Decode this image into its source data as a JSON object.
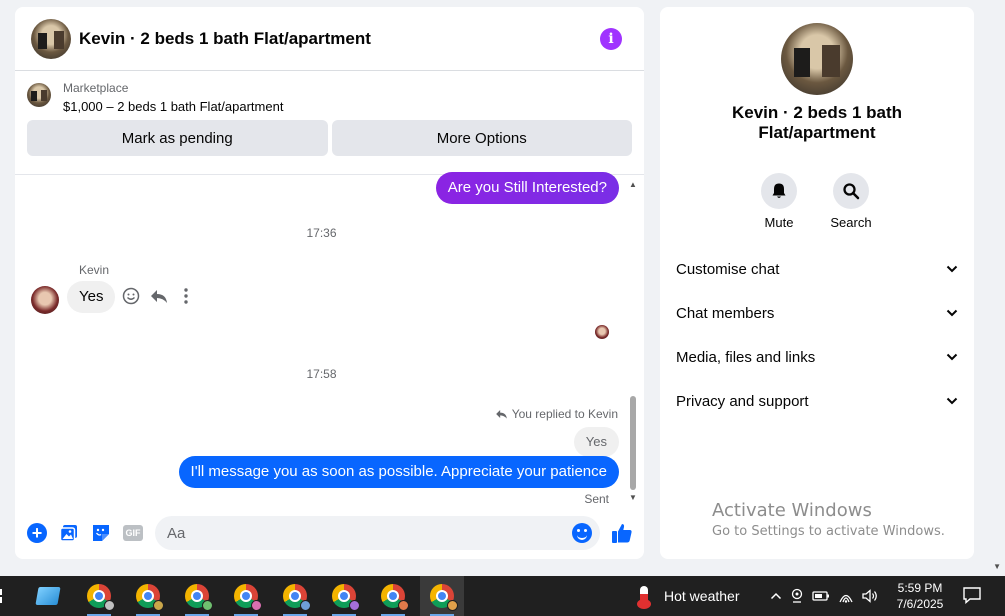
{
  "chat": {
    "title": "Kevin · 2 beds 1 bath Flat/apartment",
    "info_icon": "i",
    "marketplace": {
      "label": "Marketplace",
      "listing": "$1,000 – 2 beds 1 bath Flat/apartment"
    },
    "actions": {
      "mark_pending": "Mark as pending",
      "more_options": "More Options"
    },
    "messages": {
      "outgoing_question": "Are you Still Interested?",
      "time_1": "17:36",
      "sender_name": "Kevin",
      "incoming_reply": "Yes",
      "time_2": "17:58",
      "replied_note": "You replied to Kevin",
      "quoted": "Yes",
      "outgoing_reply": "I'll message you as soon as possible. Appreciate your patience",
      "status": "Sent"
    },
    "composer": {
      "placeholder": "Aa",
      "gif_label": "GIF"
    }
  },
  "info_panel": {
    "name": "Kevin · 2 beds 1 bath Flat/apartment",
    "mute_label": "Mute",
    "search_label": "Search",
    "sections": [
      "Customise chat",
      "Chat members",
      "Media, files and links",
      "Privacy and support"
    ]
  },
  "watermark": {
    "title": "Activate Windows",
    "subtitle": "Go to Settings to activate Windows."
  },
  "taskbar": {
    "weather": "Hot weather",
    "time": "5:59 PM",
    "date": "7/6/2025"
  },
  "colors": {
    "accent_blue": "#0866ff",
    "purple": "#8a2be2",
    "info_purple": "#a033ff",
    "taskbar": "#202020"
  }
}
